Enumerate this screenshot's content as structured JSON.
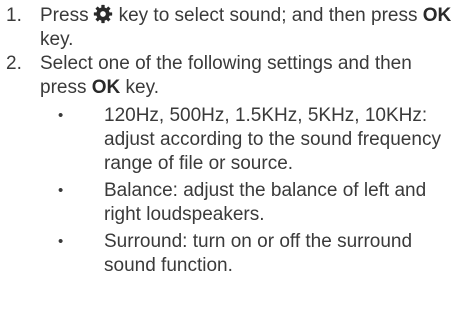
{
  "steps": [
    {
      "num": "1.",
      "pre": "Press",
      "icon": "gear-icon",
      "mid": "key to select sound; and then press",
      "key": "OK",
      "post": "key."
    },
    {
      "num": "2.",
      "pre": "Select one of the following settings and then press",
      "key": "OK",
      "post": "key."
    }
  ],
  "bullets": [
    {
      "symbol": "•",
      "text": "120Hz, 500Hz, 1.5KHz, 5KHz, 10KHz: adjust according to the sound frequency range of file or source."
    },
    {
      "symbol": "•",
      "text": "Balance: adjust the balance of left and right loudspeakers."
    },
    {
      "symbol": "•",
      "text": "Surround: turn on or off the surround sound function."
    }
  ]
}
